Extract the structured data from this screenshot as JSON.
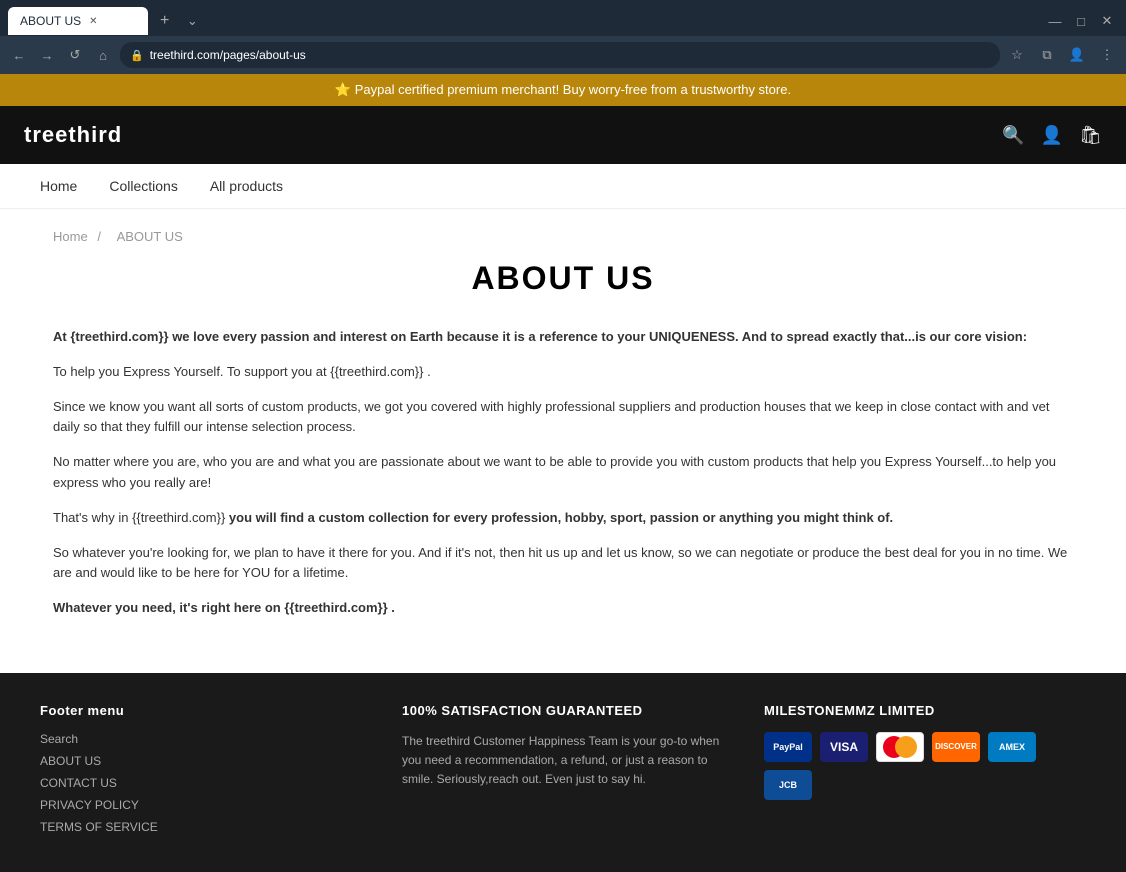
{
  "browser": {
    "tab_title": "ABOUT US",
    "url": "treethird.com/pages/about-us",
    "controls": {
      "back": "←",
      "forward": "→",
      "reload": "↺",
      "home": "⌂"
    }
  },
  "promo_banner": "⭐ Paypal certified premium merchant! Buy worry-free from a trustworthy store.",
  "header": {
    "logo": "treethird",
    "icons": {
      "search": "🔍",
      "account": "👤",
      "cart": "🛍"
    }
  },
  "nav": {
    "items": [
      "Home",
      "Collections",
      "All products"
    ]
  },
  "breadcrumb": {
    "home": "Home",
    "separator": "/",
    "current": "ABOUT US"
  },
  "page_title": "ABOUT US",
  "about": {
    "paragraphs": [
      {
        "html": "<strong>At {treethird.com}}  we love every passion and interest on Earth because it is a reference to your UNIQUENESS. And to spread exactly that...is our core vision:</strong>"
      },
      {
        "html": "To help you Express Yourself. To support you at {{treethird.com}} ."
      },
      {
        "html": "Since we know you want all sorts of custom products, we got you covered with highly professional suppliers and production houses that we keep in close contact with and vet daily so that they fulfill our intense selection process."
      },
      {
        "html": "No matter where you are, who you are and what you are passionate about we want to be able to provide you with custom products that help you Express Yourself...to help you express who you really are!"
      },
      {
        "html": "That's why in {{treethird.com}}  <strong>you will find a custom collection for every profession, hobby, sport, passion or anything you might think of.</strong>"
      },
      {
        "html": "So whatever you're looking for, we plan to have it there for you. And if it's not, then hit us up and let us know, so we can negotiate or produce the best deal for you in no time. We are and would like to be here for YOU for a lifetime."
      },
      {
        "html": "<strong>Whatever you need, it's right here on {{treethird.com}} .</strong>"
      }
    ]
  },
  "footer": {
    "col1": {
      "title": "Footer menu",
      "links": [
        "Search",
        "ABOUT US",
        "CONTACT US",
        "PRIVACY POLICY",
        "TERMS OF SERVICE"
      ]
    },
    "col2": {
      "title": "100% SATISFACTION GUARANTEED",
      "text": "The treethird Customer Happiness Team is your go-to when you need a recommendation, a refund, or just a reason to smile. Seriously,reach out. Even just to say hi."
    },
    "col3": {
      "title": "MILESTONEMMZ LIMITED"
    },
    "payment_cards": [
      {
        "name": "PayPal",
        "class": "card-paypal",
        "label": "PayPal"
      },
      {
        "name": "Visa",
        "class": "card-visa",
        "label": "VISA"
      },
      {
        "name": "Mastercard",
        "class": "card-mc",
        "label": "MC"
      },
      {
        "name": "Discover",
        "class": "card-discover",
        "label": "DISCOVER"
      },
      {
        "name": "Amex",
        "class": "card-amex",
        "label": "AMEX"
      },
      {
        "name": "JCB",
        "class": "card-jcb",
        "label": "JCB"
      }
    ]
  }
}
